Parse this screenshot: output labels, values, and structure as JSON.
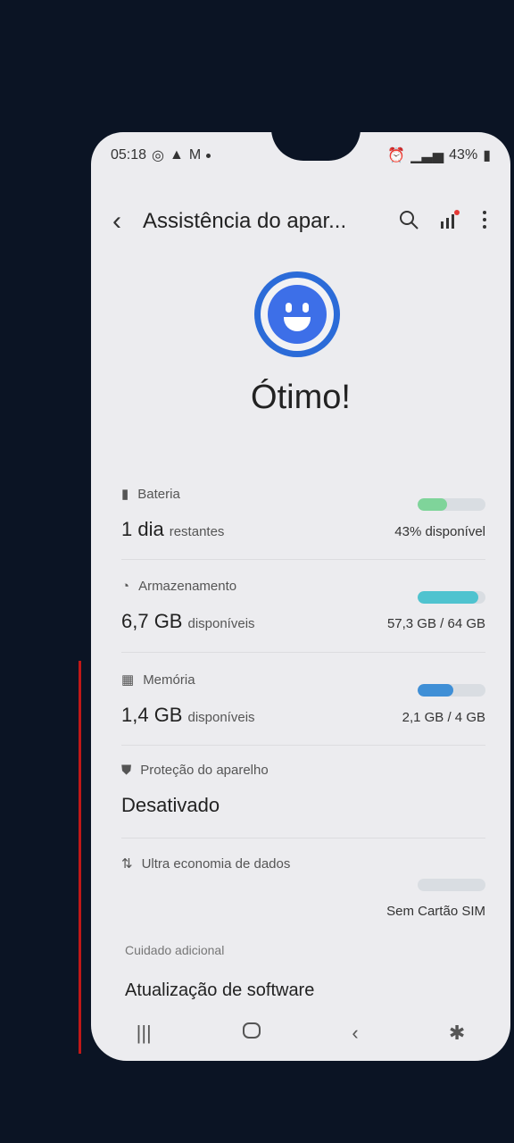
{
  "statusbar": {
    "time": "05:18",
    "battery": "43%"
  },
  "appbar": {
    "title": "Assistência do apar..."
  },
  "status": {
    "text": "Ótimo!"
  },
  "battery": {
    "label": "Bateria",
    "value": "1 dia",
    "unit": "restantes",
    "right": "43% disponível",
    "fill": 0.43,
    "color": "#7fd49a"
  },
  "storage": {
    "label": "Armazenamento",
    "value": "6,7 GB",
    "unit": "disponíveis",
    "right": "57,3 GB / 64 GB",
    "fill": 0.9,
    "color": "#4fc3cf"
  },
  "memory": {
    "label": "Memória",
    "value": "1,4 GB",
    "unit": "disponíveis",
    "right": "2,1 GB / 4 GB",
    "fill": 0.52,
    "color": "#3f8fd6"
  },
  "protection": {
    "label": "Proteção do aparelho",
    "value": "Desativado"
  },
  "data_saver": {
    "label": "Ultra economia de dados",
    "right": "Sem Cartão SIM"
  },
  "care": {
    "header": "Cuidado adicional",
    "item": "Atualização de software"
  }
}
